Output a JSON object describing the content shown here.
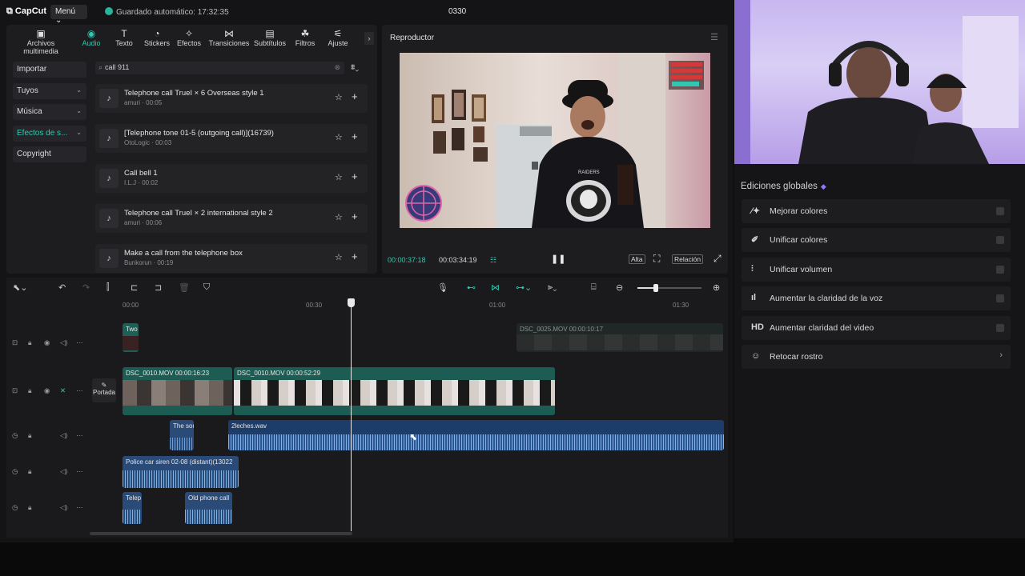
{
  "app": {
    "logo": "CapCut",
    "menu_label": "Menú",
    "autosave": "Guardado automático: 17:32:35",
    "project_name": "0330"
  },
  "tools": [
    {
      "label": "Archivos multimedia",
      "icon": "media-icon"
    },
    {
      "label": "Audio",
      "icon": "audio-icon"
    },
    {
      "label": "Texto",
      "icon": "text-icon"
    },
    {
      "label": "Stickers",
      "icon": "sticker-icon"
    },
    {
      "label": "Efectos",
      "icon": "effects-icon"
    },
    {
      "label": "Transiciones",
      "icon": "transition-icon"
    },
    {
      "label": "Subtítulos",
      "icon": "subtitles-icon"
    },
    {
      "label": "Filtros",
      "icon": "filters-icon"
    },
    {
      "label": "Ajuste",
      "icon": "adjust-icon"
    }
  ],
  "categories": [
    {
      "label": "Importar"
    },
    {
      "label": "Tuyos"
    },
    {
      "label": "Música"
    },
    {
      "label": "Efectos de s..."
    },
    {
      "label": "Copyright"
    }
  ],
  "search": {
    "value": "call 911"
  },
  "results": [
    {
      "title": "Telephone call TrueI × 6 Overseas style 1",
      "meta": "amuri · 00:05"
    },
    {
      "title": "[Telephone tone 01-5 (outgoing call)](16739)",
      "meta": "OtoLogic · 00:03"
    },
    {
      "title": "Call bell 1",
      "meta": "I.L.J · 00:02"
    },
    {
      "title": "Telephone call TrueI × 2 international style 2",
      "meta": "amuri · 00:06"
    },
    {
      "title": "Make a call from the telephone box",
      "meta": "Bunkorun · 00:19"
    }
  ],
  "player": {
    "title": "Reproductor",
    "time_current": "00:00:37:18",
    "time_total": "00:03:34:19",
    "quality": "Alta",
    "ratio": "Relación",
    "shirt_text": "RAIDERS"
  },
  "timeline": {
    "ruler": [
      "00:00",
      "00:30",
      "01:00",
      "01:30"
    ],
    "cover_label": "Portada",
    "clips": {
      "overlay_small": "Two",
      "overlay_dim": "DSC_0025.MOV  00:00:10:17",
      "main1": "DSC_0010.MOV   00:00:16:23",
      "main2": "DSC_0010.MOV   00:00:52:29",
      "audio1": "The sou",
      "audio2": "2leches.wav",
      "siren": "Police car siren 02-08 (distant)(13022",
      "tel": "Telep",
      "oldphone": "Old phone call"
    }
  },
  "global_edits": {
    "title": "Ediciones globales",
    "items": [
      {
        "label": "Mejorar colores",
        "icon": "magic-wand-icon"
      },
      {
        "label": "Unificar colores",
        "icon": "brush-icon"
      },
      {
        "label": "Unificar volumen",
        "icon": "sliders-icon"
      },
      {
        "label": "Aumentar la claridad de la voz",
        "icon": "voice-icon"
      },
      {
        "label": "Aumentar claridad del video",
        "icon": "hd-icon",
        "glyph": "HD"
      },
      {
        "label": "Retocar rostro",
        "icon": "face-icon"
      }
    ]
  },
  "colors": {
    "accent": "#2fc7b0",
    "panel": "#1d1d20",
    "background": "#141416"
  }
}
